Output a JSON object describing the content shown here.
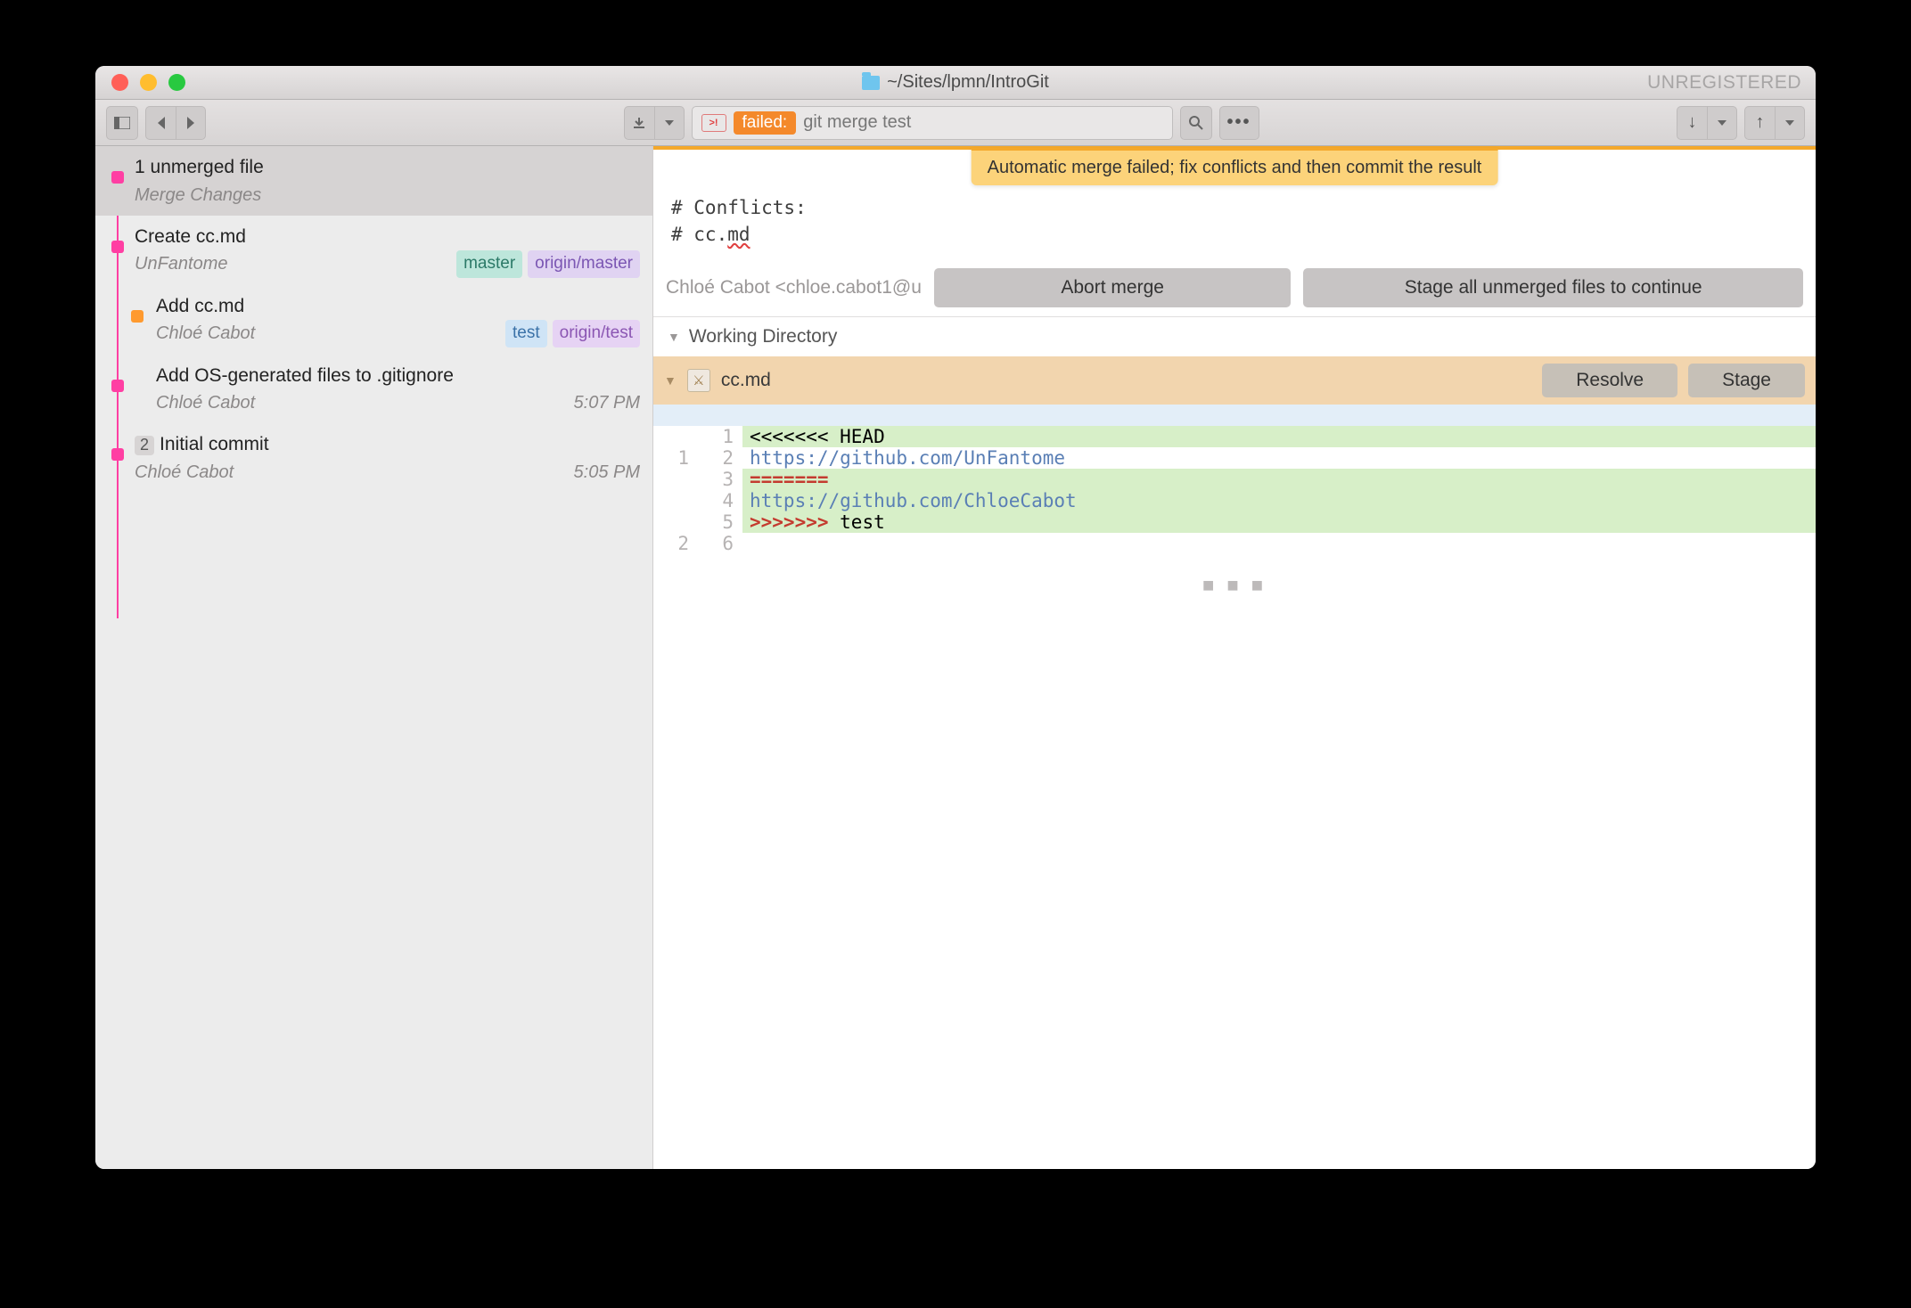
{
  "title": "~/Sites/lpmn/IntroGit",
  "unregistered": "UNREGISTERED",
  "cmd": {
    "failed_label": "failed:",
    "text": "git merge test"
  },
  "banner": "Automatic merge failed; fix conflicts and then commit the result",
  "commits": [
    {
      "title": "1 unmerged file",
      "sub": "Merge Changes"
    },
    {
      "title": "Create cc.md",
      "sub": "UnFantome",
      "badges": [
        "master",
        "origin/master"
      ]
    },
    {
      "title": "Add cc.md",
      "sub": "Chloé Cabot",
      "badges": [
        "test",
        "origin/test"
      ]
    },
    {
      "title": "Add OS-generated files to .gitignore",
      "sub": "Chloé Cabot",
      "time": "5:07 PM"
    },
    {
      "count": "2",
      "title": "Initial commit",
      "sub": "Chloé Cabot",
      "time": "5:05 PM"
    }
  ],
  "message": {
    "l1": "# Conflicts:",
    "l2_prefix": "#   cc.",
    "l2_squig": "md"
  },
  "author": "Chloé Cabot <chloe.cabot1@u",
  "buttons": {
    "abort": "Abort merge",
    "stage_all": "Stage all unmerged files to continue",
    "resolve": "Resolve",
    "stage": "Stage"
  },
  "section": "Working Directory",
  "file": "cc.md",
  "diff": {
    "head": "<<<<<<< HEAD",
    "url1": "https://github.com/UnFantome",
    "sep": "=======",
    "url2": "https://github.com/ChloeCabot",
    "tail_marker": ">>>>>>> ",
    "tail_rest": "test"
  }
}
